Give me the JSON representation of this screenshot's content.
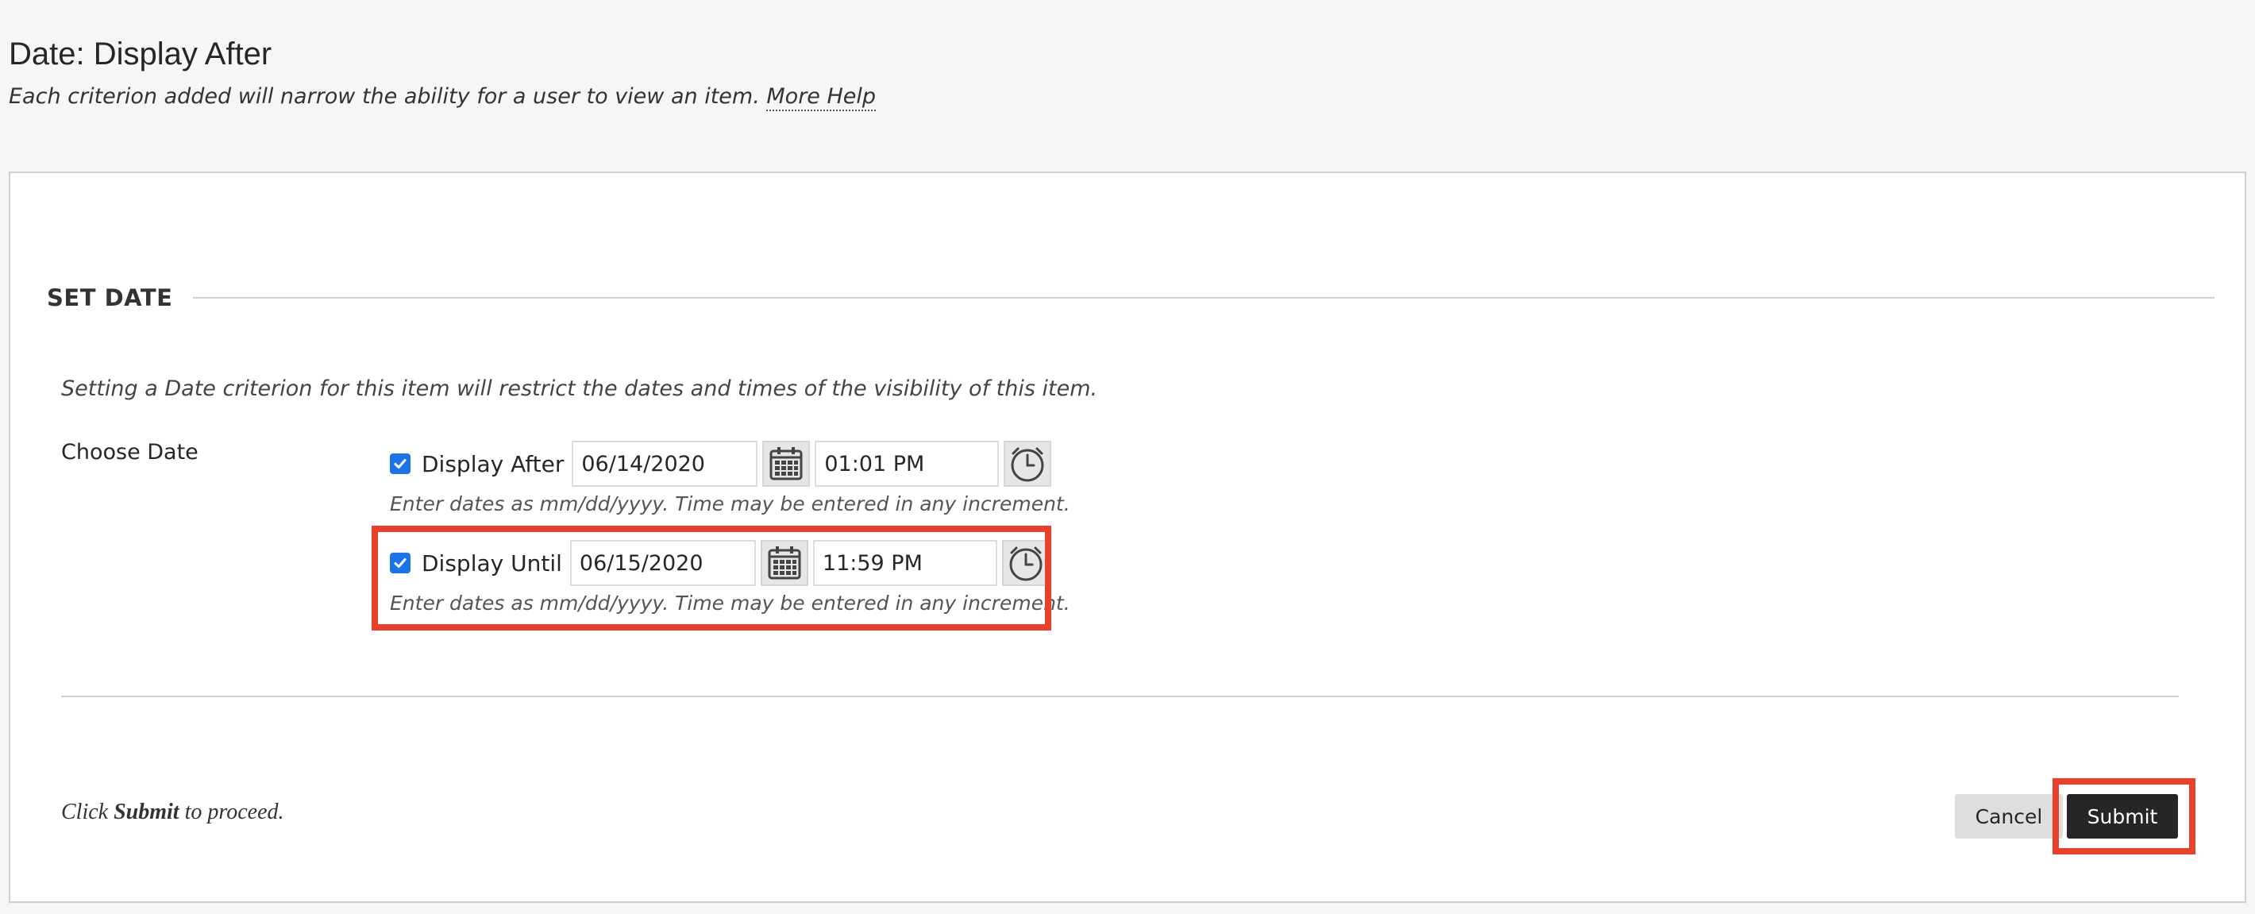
{
  "page": {
    "title": "Date: Display After",
    "subtitle": "Each criterion added will narrow the ability for a user to view an item.",
    "help_link": "More Help"
  },
  "section": {
    "title": "SET DATE",
    "intro": "Setting a Date criterion for this item will restrict the dates and times of the visibility of this item.",
    "choose_label": "Choose Date"
  },
  "display_after": {
    "checked": true,
    "label": "Display After",
    "date": "06/14/2020",
    "time": "01:01 PM",
    "hint": "Enter dates as mm/dd/yyyy. Time may be entered in any increment."
  },
  "display_until": {
    "checked": true,
    "label": "Display Until",
    "date": "06/15/2020",
    "time": "11:59 PM",
    "hint": "Enter dates as mm/dd/yyyy. Time may be entered in any increment."
  },
  "footer": {
    "proceed_prefix": "Click",
    "proceed_bold": "Submit",
    "proceed_suffix": "to proceed.",
    "cancel_label": "Cancel",
    "submit_label": "Submit"
  },
  "colors": {
    "checkbox": "#1a73e8",
    "highlight": "#e8402a",
    "submit_bg": "#262626"
  },
  "icons": {
    "calendar": "calendar-icon",
    "clock": "clock-icon",
    "checkmark": "checkmark-icon"
  }
}
